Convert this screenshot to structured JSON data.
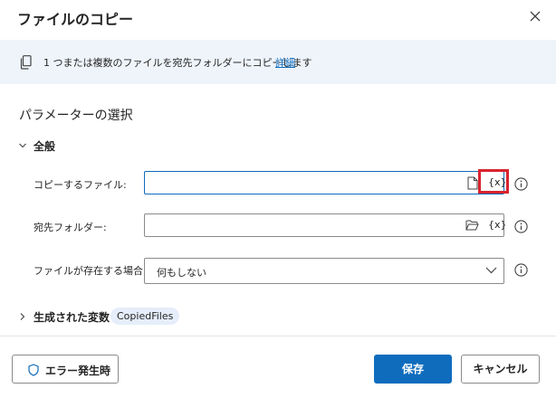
{
  "dialog": {
    "title": "ファイルのコピー"
  },
  "info": {
    "text": "1 つまたは複数のファイルを宛先フォルダーにコピーします",
    "link": "詳細"
  },
  "parameters": {
    "section_title": "パラメーターの選択",
    "general_label": "全般",
    "fields": {
      "files_to_copy": {
        "label": "コピーするファイル:",
        "value": "",
        "var_button": "{x}"
      },
      "destination_folder": {
        "label": "宛先フォルダー:",
        "value": "",
        "var_button": "{x}"
      },
      "if_file_exists": {
        "label": "ファイルが存在する場合:",
        "selected": "何もしない"
      }
    }
  },
  "variables": {
    "label": "生成された変数",
    "chip": "CopiedFiles"
  },
  "footer": {
    "error_button": "エラー発生時",
    "save_button": "保存",
    "cancel_button": "キャンセル"
  },
  "colors": {
    "accent": "#0f6cbd",
    "highlight": "#d9232e",
    "info_bar": "#eff4fb"
  },
  "icons": {
    "close": "close-icon",
    "copy": "copy-icon",
    "file": "file-icon",
    "folder": "folder-icon",
    "help": "info-circle-icon",
    "chevron": "chevron-icon",
    "shield": "shield-icon"
  }
}
